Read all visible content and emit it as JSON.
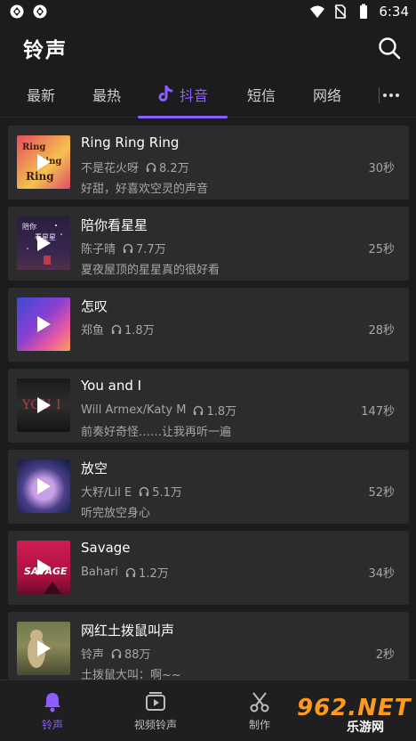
{
  "status_bar": {
    "time": "6:34"
  },
  "header": {
    "title": "铃声"
  },
  "tabs": [
    {
      "label": "最新"
    },
    {
      "label": "最热"
    },
    {
      "label": "抖音"
    },
    {
      "label": "短信"
    },
    {
      "label": "网络"
    }
  ],
  "active_tab": "抖音",
  "accent_color": "#8f5cff",
  "items": [
    {
      "title": "Ring Ring Ring",
      "artist": "不是花火呀",
      "plays": "8.2万",
      "desc": "好甜，好喜欢空灵的声音",
      "duration": "30秒",
      "thumb_text": "Ring Ring Ring"
    },
    {
      "title": "陪你看星星",
      "artist": "陈子晴",
      "plays": "7.7万",
      "desc": "夏夜屋顶的星星真的很好看",
      "duration": "25秒",
      "thumb_text": "陪你 看星星"
    },
    {
      "title": "怎叹",
      "artist": "郑鱼",
      "plays": "1.8万",
      "desc": "",
      "duration": "28秒"
    },
    {
      "title": "You and I",
      "artist": "Will Armex/Katy M",
      "plays": "1.8万",
      "desc": "前奏好奇怪……让我再听一遍",
      "duration": "147秒",
      "thumb_text": "YOU & I"
    },
    {
      "title": "放空",
      "artist": "大籽/Lil E",
      "plays": "5.1万",
      "desc": "听完放空身心",
      "duration": "52秒"
    },
    {
      "title": "Savage",
      "artist": "Bahari",
      "plays": "1.2万",
      "desc": "",
      "duration": "34秒",
      "thumb_text": "SAVAGE"
    },
    {
      "title": "网红土拨鼠叫声",
      "artist": "铃声",
      "plays": "88万",
      "desc": "土拨鼠大叫：啊~~",
      "duration": "2秒"
    }
  ],
  "bottom_nav": [
    {
      "label": "铃声"
    },
    {
      "label": "视频铃声"
    },
    {
      "label": "制作"
    }
  ],
  "watermark": {
    "logo": "962.NET",
    "sub": "乐游网"
  }
}
